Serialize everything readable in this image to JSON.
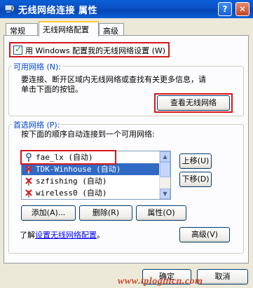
{
  "window": {
    "title": "无线网络连接 属性",
    "help": "?",
    "close": "✕"
  },
  "tabs": [
    {
      "label": "常规"
    },
    {
      "label": "无线网络配置"
    },
    {
      "label": "高级"
    }
  ],
  "use_windows_checkbox": {
    "label": "用 Windows 配置我的无线网络设置 (W)",
    "checked": true
  },
  "available_networks": {
    "legend": "可用网络 (N):",
    "description_line1": "要连接、断开区域内无线网络或查找有关更多信息，请",
    "description_line2": "单击下面的按钮。",
    "view_button": "查看无线网络"
  },
  "preferred_networks": {
    "legend": "首选网络 (P):",
    "description": "按下面的顺序自动连接到一个可用网络:",
    "items": [
      {
        "label": "fae_lx (自动)",
        "icon": "antenna-icon"
      },
      {
        "label": "TDK-Winhouse (自动)",
        "icon": "wireless-disconnected-icon"
      },
      {
        "label": "szfishing (自动)",
        "icon": "wireless-disconnected-icon"
      },
      {
        "label": "wireless0 (自动)",
        "icon": "wireless-disconnected-icon"
      }
    ],
    "move_up": "上移(U)",
    "move_down": "下移(D)",
    "add": "添加(A)...",
    "remove": "删除(R)",
    "properties": "属性(O)"
  },
  "learn_more": {
    "prefix": "了解",
    "link": "设置无线网络配置",
    "suffix": "。"
  },
  "advanced_button": "高级(V)",
  "ok_button": "确定",
  "cancel_button": "取消",
  "watermark": "www.tplogincn.com",
  "colors": {
    "titlebar": "#0a5fd6",
    "selection": "#316ac5",
    "annotation": "#d6161a",
    "legend": "#0046d5"
  }
}
